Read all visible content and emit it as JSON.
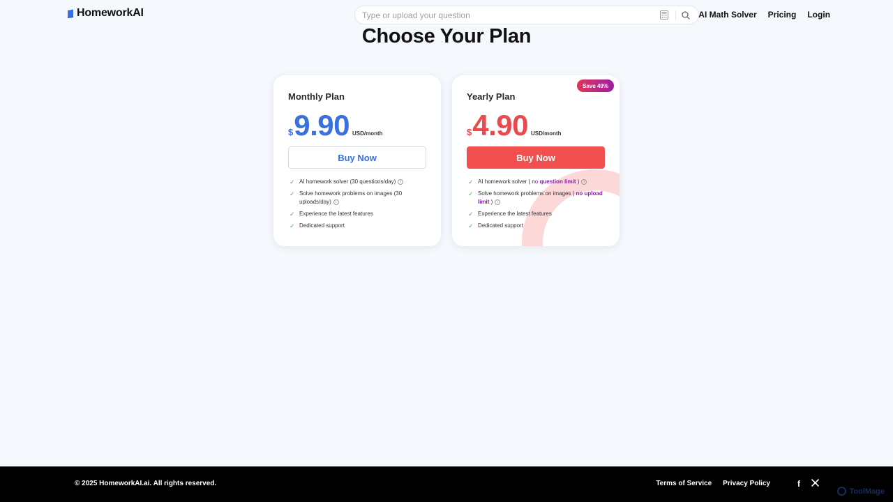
{
  "header": {
    "logo_text": "HomeworkAI",
    "search_placeholder": "Type or upload your question",
    "nav": [
      "AI Math Solver",
      "Pricing",
      "Login"
    ]
  },
  "page_title": "Choose Your Plan",
  "plans": [
    {
      "name": "Monthly Plan",
      "currency": "$",
      "amount": "9.90",
      "unit": "USD/month",
      "button": "Buy Now",
      "features": {
        "f1": "AI homework solver (30 questions/day)",
        "f2": "Solve homework problems on images (30 uploads/day)",
        "f3": "Experience the latest features",
        "f4": "Dedicated support"
      }
    },
    {
      "name": "Yearly Plan",
      "badge": "Save 49%",
      "currency": "$",
      "amount": "4.90",
      "unit": "USD/month",
      "button": "Buy Now",
      "features": {
        "f1_pre": "AI homework solver ( ",
        "f1_hl1": "no",
        "f1_hl2": "question limit",
        "f1_post": " )",
        "f2_pre": "Solve homework problems on images ( ",
        "f2_hl": "no upload limit",
        "f2_post": " )",
        "f3": "Experience the latest features",
        "f4": "Dedicated support"
      }
    }
  ],
  "footer": {
    "copyright": "© 2025 HomeworkAI.ai. All rights reserved.",
    "links": [
      "Terms of Service",
      "Privacy Policy"
    ],
    "social": [
      "facebook-icon",
      "x-icon"
    ],
    "watermark": "ToolMage"
  },
  "colors": {
    "monthly_accent": "#3a6fe0",
    "yearly_accent": "#ea4a4e",
    "highlight": "#8a1fa5",
    "check": "#4caf50"
  }
}
